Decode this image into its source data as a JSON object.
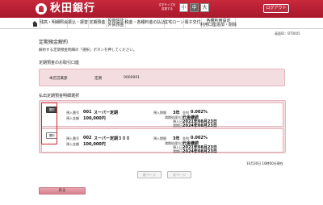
{
  "header": {
    "logo_text": "秋田銀行",
    "fontsize_label": "文字サイズを変更する",
    "fontsize_buttons": [
      "小",
      "中",
      "大"
    ],
    "logout_label": "ログアウト"
  },
  "nav": [
    {
      "label": "残高・明細照会"
    },
    {
      "label": "振込・振替"
    },
    {
      "label": "定期預金"
    },
    {
      "label": "投資信託\n外貨預金"
    },
    {
      "label": "税金・各種料金の払込"
    },
    {
      "label": "住宅ローン"
    },
    {
      "label": "電子交付"
    },
    {
      "label": "各種利用設定\n利用口座追加・削除"
    }
  ],
  "screen_id": "画面ID：BT0005",
  "page_title": "定期預金解約",
  "page_desc": "解約する定期預金明細の「選択」ボタンを押してください。",
  "account_section": {
    "title": "定期預金のお取引口座",
    "branch": "本店営業部",
    "type": "定期",
    "number": "0000001"
  },
  "list_section": {
    "title": "払出定期預金明細選択",
    "select_label": "選択",
    "labels": {
      "deposit_no": "預入番号",
      "amount": "預入金額",
      "period": "預入期間",
      "rate": "金利",
      "maturity_method": "満期処理方法",
      "deposit_date": "預入日",
      "maturity_date": "満期日"
    },
    "rows": [
      {
        "no": "001",
        "name": "スーパー定期",
        "amount": "100,000円",
        "period": "3年",
        "rate": "0.002%",
        "maturity_method": "元金継続",
        "deposit_date": "2021年08月23日",
        "maturity_date": "2024年08月23日"
      },
      {
        "no": "002",
        "name": "スーパー定期３００",
        "amount": "100,000円",
        "period": "3年",
        "rate": "0.002%",
        "maturity_method": "元金継続",
        "deposit_date": "2021年08月23日",
        "maturity_date": "2024年08月23日"
      }
    ]
  },
  "pager": {
    "prev": "前ページ",
    "next": "次ページ"
  },
  "as_of": "10月30日 10時00分現在",
  "back_label": "戻る"
}
